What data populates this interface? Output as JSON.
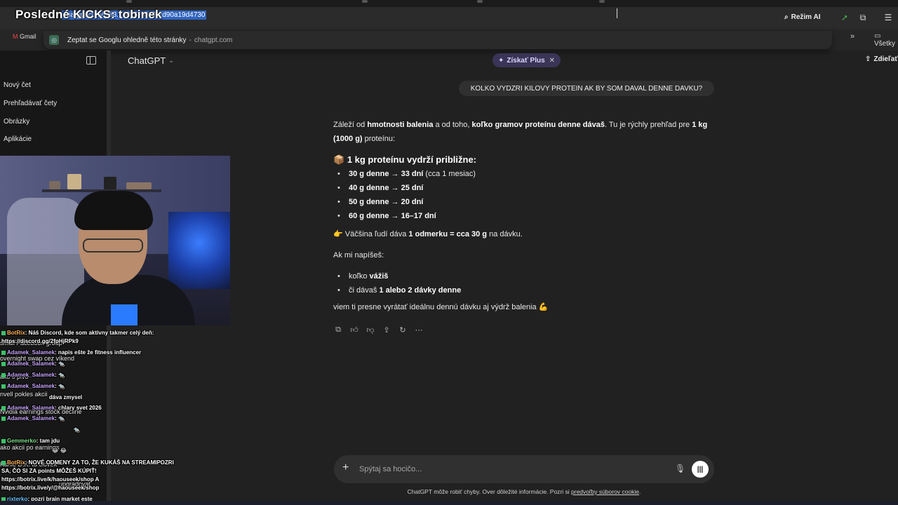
{
  "browser": {
    "stream_title": "Posledné KICKS: tobinek",
    "url": "chatgpt.com/c/68...0825-9080-2d90a19d4730",
    "ai_mode": "Režim AI",
    "bookmark_gmail": "Gmail",
    "bookmarks_folder": "Všetky",
    "suggest_text": "Zeptat se Googlu ohledně této stránky",
    "suggest_domain": "chatgpt.com"
  },
  "sidebar": {
    "items": [
      {
        "label": "Nový čet"
      },
      {
        "label": "Prehľadávať čety"
      },
      {
        "label": "Obrázky"
      },
      {
        "label": "Aplikácie"
      }
    ]
  },
  "header": {
    "model": "ChatGPT",
    "upgrade": "Získať Plus",
    "share": "Zdieľať"
  },
  "conversation": {
    "user_message": "KOLKO VYDZRI KILOVY PROTEIN AK BY SOM DAVAL DENNE DAVKU?",
    "intro": {
      "p1": "Záleží od ",
      "b1": "hmotnosti balenia",
      "p2": " a od toho, ",
      "b2": "koľko gramov proteínu denne dávaš",
      "p3": ". Tu je rýchly prehľad pre ",
      "b3": "1 kg (1000 g)",
      "p4": " proteínu:"
    },
    "heading_emoji": "📦",
    "heading": "1 kg proteínu vydrží približne:",
    "doses": [
      {
        "dose": "30 g denne → 33 dní",
        "note": " (cca 1 mesiac)"
      },
      {
        "dose": "40 g denne → 25 dní",
        "note": ""
      },
      {
        "dose": "50 g denne → 20 dní",
        "note": ""
      },
      {
        "dose": "60 g denne → 16–17 dní",
        "note": ""
      }
    ],
    "tip": {
      "emoji": "👉",
      "p1": "Väčšina ľudí dáva ",
      "b1": "1 odmerku = cca 30 g",
      "p2": " na dávku."
    },
    "ask": "Ak mi napíšeš:",
    "ask_items": [
      {
        "p": "koľko ",
        "b": "vážiš"
      },
      {
        "p": "či dávaš ",
        "b": "1 alebo 2 dávky denne"
      }
    ],
    "closing": "viem ti presne vyrátať ideálnu dennú dávku aj výdrž balenia 💪"
  },
  "composer": {
    "placeholder": "Spýtaj sa hocičo...",
    "disclaimer": "ChatGPT môže robiť chyby. Over dôležité informácie. Pozri si ",
    "disclaimer_link": "predvoľby súborov cookie",
    "disclaimer_end": "."
  },
  "stream_chat": {
    "messages": [
      {
        "user": "BotRix",
        "cls": "o",
        "text": ": Náš Discord, kde som aktívny takmer celý deň:"
      },
      {
        "user": "",
        "cls": "",
        "text": "https://discord.gg/2fpHjRPk9"
      },
      {
        "user": "Adamek_Salamek",
        "cls": "",
        "text": ": napis ešte že fitness influencer"
      },
      {
        "user": "Adamek_Salamek",
        "cls": "",
        "text": ": 🐀"
      },
      {
        "user": "Adamek_Salamek",
        "cls": "",
        "text": ": 🐀"
      },
      {
        "user": "Adamek_Salamek",
        "cls": "",
        "text": ": 🐀"
      },
      {
        "user": "",
        "cls": "",
        "text": "dáva zmysel"
      },
      {
        "user": "Adamek_Salamek",
        "cls": "",
        "text": ": chlary svet 2026"
      },
      {
        "user": "Adamek_Salamek",
        "cls": "",
        "text": ": 🐀"
      },
      {
        "user": "",
        "cls": "",
        "text": "🐀"
      },
      {
        "user": "Gemmerko",
        "cls": "g",
        "text": ": tam jdu"
      },
      {
        "user": "",
        "cls": "",
        "text": "😂 😂"
      },
      {
        "user": "BotRix",
        "cls": "o",
        "text": ": NOVÉ ODMENY ZA TO, ŽE KUKÁŠ NA STREAMIPOZRI"
      },
      {
        "user": "",
        "cls": "",
        "text": "SA, ČO SI ZA points MÔŽEŠ KÚPIŤ!"
      },
      {
        "user": "",
        "cls": "",
        "text": "https://botrix.live/k/haouseek/shop A"
      },
      {
        "user": "",
        "cls": "",
        "text": "https://botrix.live/y/@haouseek/shop"
      },
      {
        "user": "rixterko",
        "cls": "b",
        "text": ": pozri brain market este"
      }
    ],
    "ghost_lines": [
      {
        "text": "small Facebook group"
      },
      {
        "text": "overnight swap cez víkend"
      },
      {
        "text": "ako ti plvo"
      },
      {
        "text": "nvell pokles akcii"
      },
      {
        "text": "Nvidia earnings stock decline"
      },
      {
        "text": "ako akcii po earnings"
      },
      {
        "text": "Karlie D.K. tu clovek"
      },
      {
        "text": "upgradovat"
      }
    ]
  }
}
